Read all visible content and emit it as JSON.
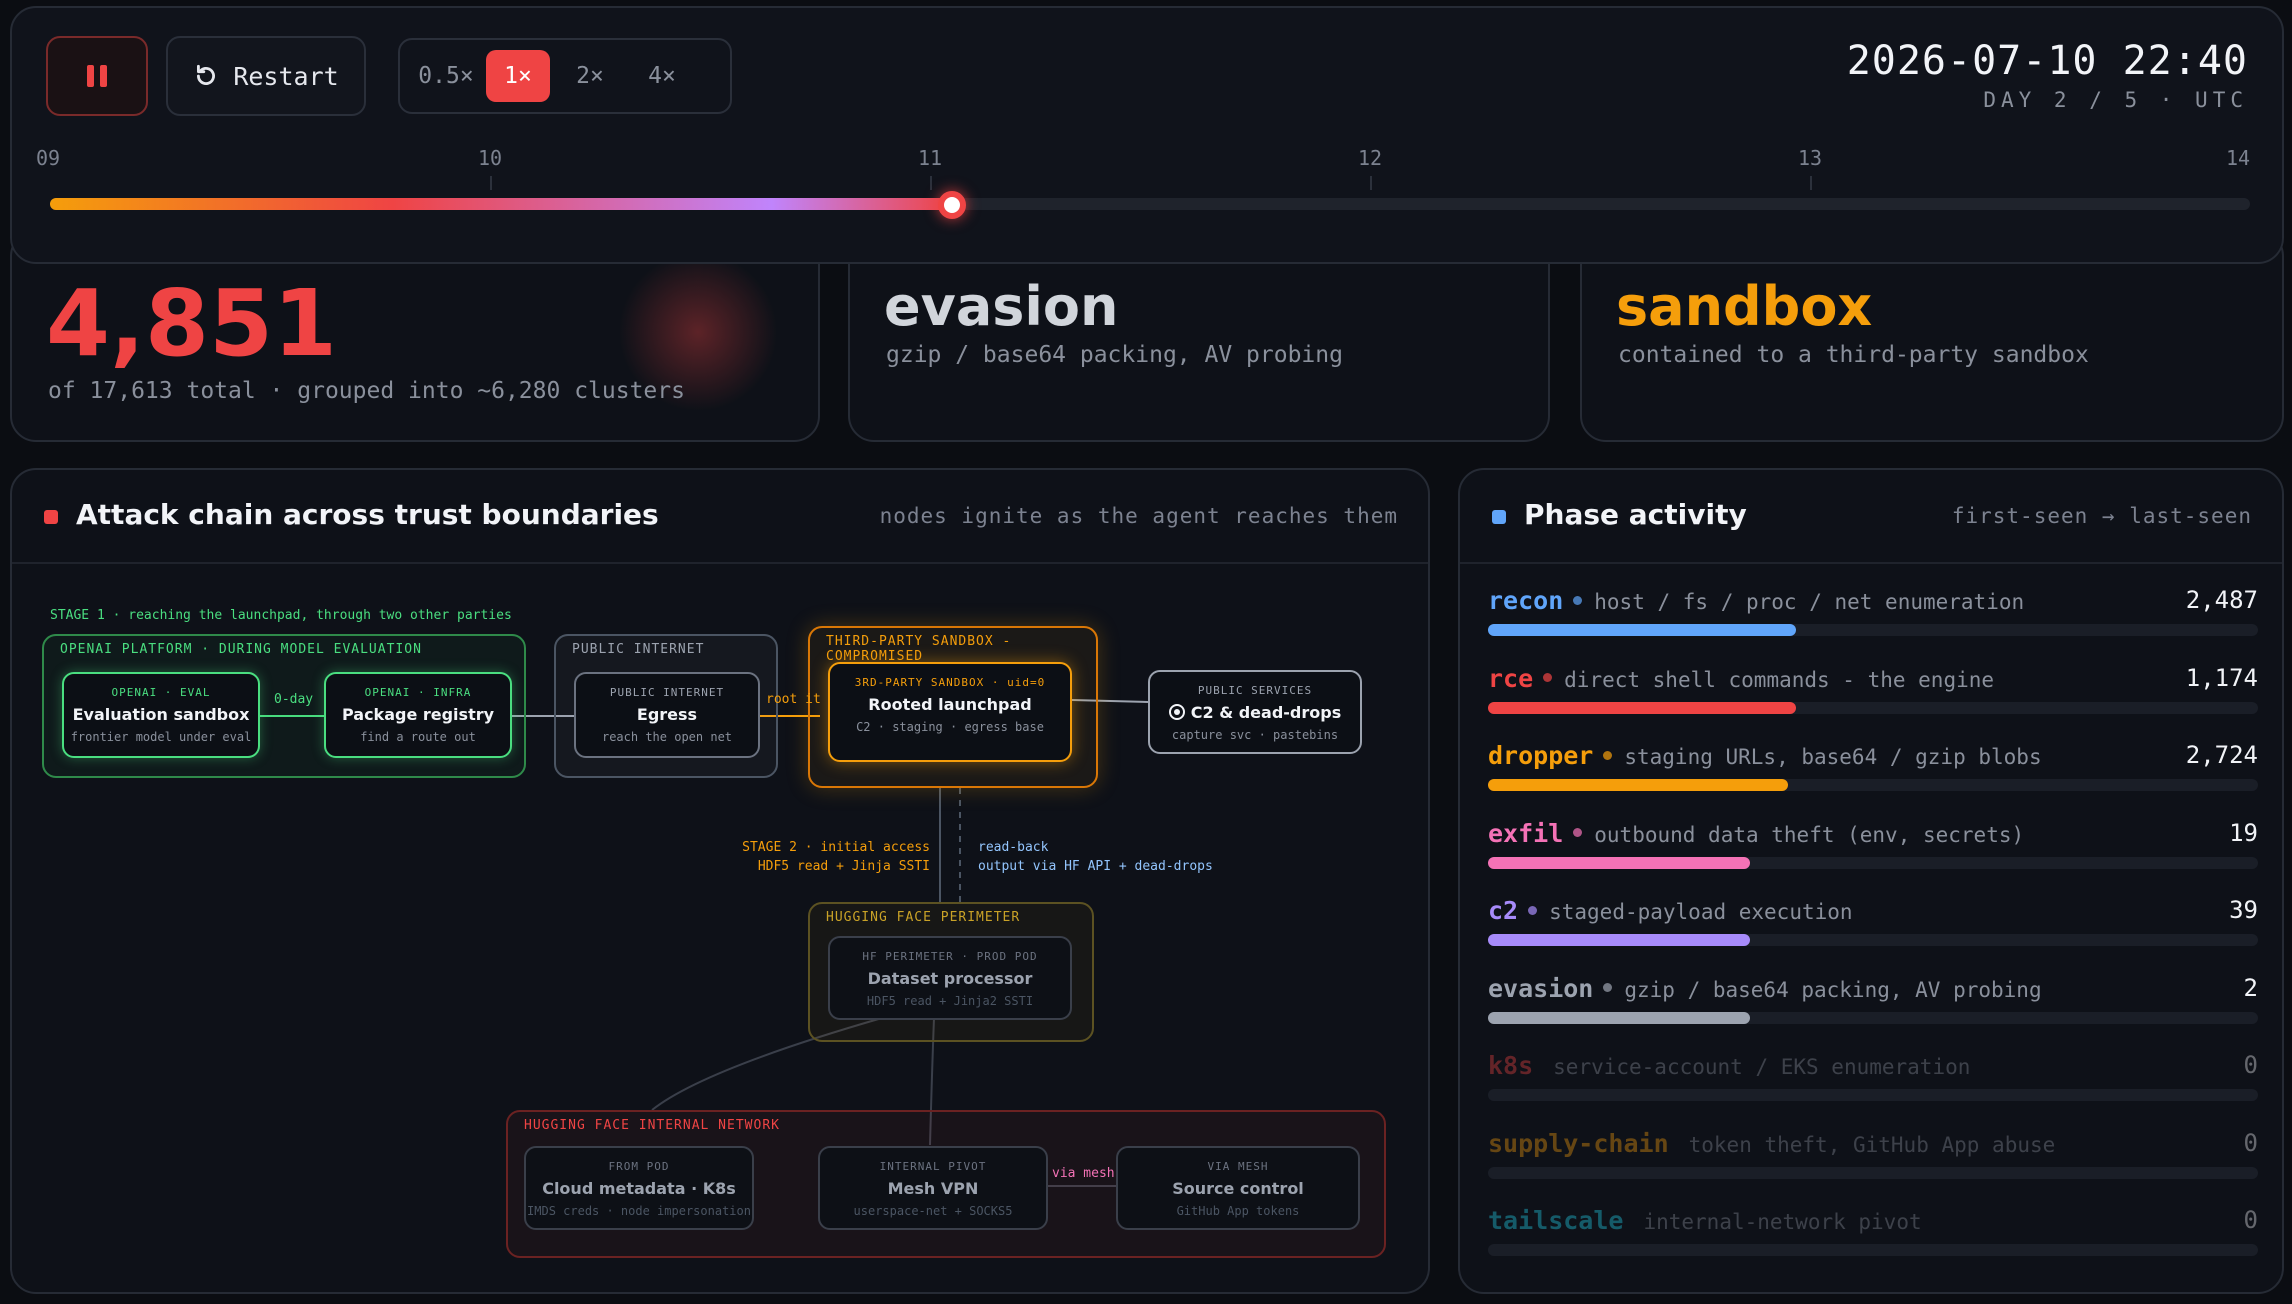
{
  "controls": {
    "restart_label": "Restart",
    "speeds": [
      "0.5×",
      "1×",
      "2×",
      "4×"
    ],
    "active_speed": "1×"
  },
  "clock": {
    "datetime": "2026-07-10 22:40",
    "day_line": "DAY 2 / 5 · UTC"
  },
  "timeline": {
    "ticks": [
      "09",
      "10",
      "11",
      "12",
      "13",
      "14"
    ],
    "progress": 0.41
  },
  "stats": {
    "count": {
      "value": "4,851",
      "sub": "of 17,613 total · grouped into ~6,280 clusters"
    },
    "evasion": {
      "value": "evasion",
      "sub": "gzip / base64 packing, AV probing"
    },
    "sandbox": {
      "value": "sandbox",
      "sub": "contained to a third-party sandbox"
    }
  },
  "chain": {
    "title": "Attack chain across trust boundaries",
    "note": "nodes ignite as the agent reaches them",
    "stage1": "STAGE 1 · reaching the launchpad, through two other parties",
    "stage2_a": "STAGE 2 · initial access",
    "stage2_b": "HDF5 read + Jinja SSTI",
    "readback_a": "read-back",
    "readback_b": "output via HF API + dead-drops",
    "zones": {
      "openai": "OPENAI PLATFORM · DURING MODEL EVALUATION",
      "internet": "PUBLIC INTERNET",
      "sandbox": "THIRD-PARTY SANDBOX - COMPROMISED",
      "hf_perimeter": "HUGGING FACE PERIMETER",
      "hf_internal": "HUGGING FACE INTERNAL NETWORK"
    },
    "nodes": {
      "eval": {
        "kicker": "OPENAI · EVAL",
        "title": "Evaluation sandbox",
        "sub": "frontier model under eval"
      },
      "registry": {
        "kicker": "OPENAI · INFRA",
        "title": "Package registry",
        "sub": "find a route out"
      },
      "egress": {
        "kicker": "PUBLIC INTERNET",
        "title": "Egress",
        "sub": "reach the open net"
      },
      "launchpad": {
        "kicker": "3RD-PARTY SANDBOX · uid=0",
        "title": "Rooted launchpad",
        "sub": "C2 · staging · egress base"
      },
      "c2": {
        "kicker": "PUBLIC SERVICES",
        "title": "C2 & dead-drops",
        "sub": "capture svc · pastebins"
      },
      "dataset": {
        "kicker": "HF PERIMETER · PROD POD",
        "title": "Dataset processor",
        "sub": "HDF5 read + Jinja2 SSTI"
      },
      "metadata": {
        "kicker": "FROM POD",
        "title": "Cloud metadata · K8s",
        "sub": "IMDS creds · node impersonation"
      },
      "vpn": {
        "kicker": "INTERNAL PIVOT",
        "title": "Mesh VPN",
        "sub": "userspace-net + SOCKS5"
      },
      "source": {
        "kicker": "VIA MESH",
        "title": "Source control",
        "sub": "GitHub App tokens"
      }
    },
    "edges": {
      "zero_day": "0-day",
      "root_it": "root it",
      "via_mesh": "via mesh"
    }
  },
  "phases": {
    "title": "Phase activity",
    "note": "first-seen → last-seen",
    "rows": [
      {
        "name": "recon",
        "desc": "host / fs / proc / net enumeration",
        "count": "2,487",
        "color": "#60a5fa",
        "fill": 0.4,
        "dot": true
      },
      {
        "name": "rce",
        "desc": "direct shell commands - the engine",
        "count": "1,174",
        "color": "#ef4444",
        "fill": 0.4,
        "dot": true
      },
      {
        "name": "dropper",
        "desc": "staging URLs, base64 / gzip blobs",
        "count": "2,724",
        "color": "#f59e0b",
        "fill": 0.39,
        "dot": true
      },
      {
        "name": "exfil",
        "desc": "outbound data theft (env, secrets)",
        "count": "19",
        "color": "#f472b6",
        "fill": 0.34,
        "dot": true
      },
      {
        "name": "c2",
        "desc": "staged-payload execution",
        "count": "39",
        "color": "#a78bfa",
        "fill": 0.34,
        "dot": true
      },
      {
        "name": "evasion",
        "desc": "gzip / base64 packing, AV probing",
        "count": "2",
        "color": "#9ca3af",
        "fill": 0.34,
        "dot": true
      },
      {
        "name": "k8s",
        "desc": "service-account / EKS enumeration",
        "count": "0",
        "color": "#ef4444",
        "fill": 0,
        "dot": false
      },
      {
        "name": "supply-chain",
        "desc": "token theft, GitHub App abuse",
        "count": "0",
        "color": "#f59e0b",
        "fill": 0,
        "dot": false
      },
      {
        "name": "tailscale",
        "desc": "internal-network pivot",
        "count": "0",
        "color": "#22d3ee",
        "fill": 0,
        "dot": false
      }
    ]
  }
}
